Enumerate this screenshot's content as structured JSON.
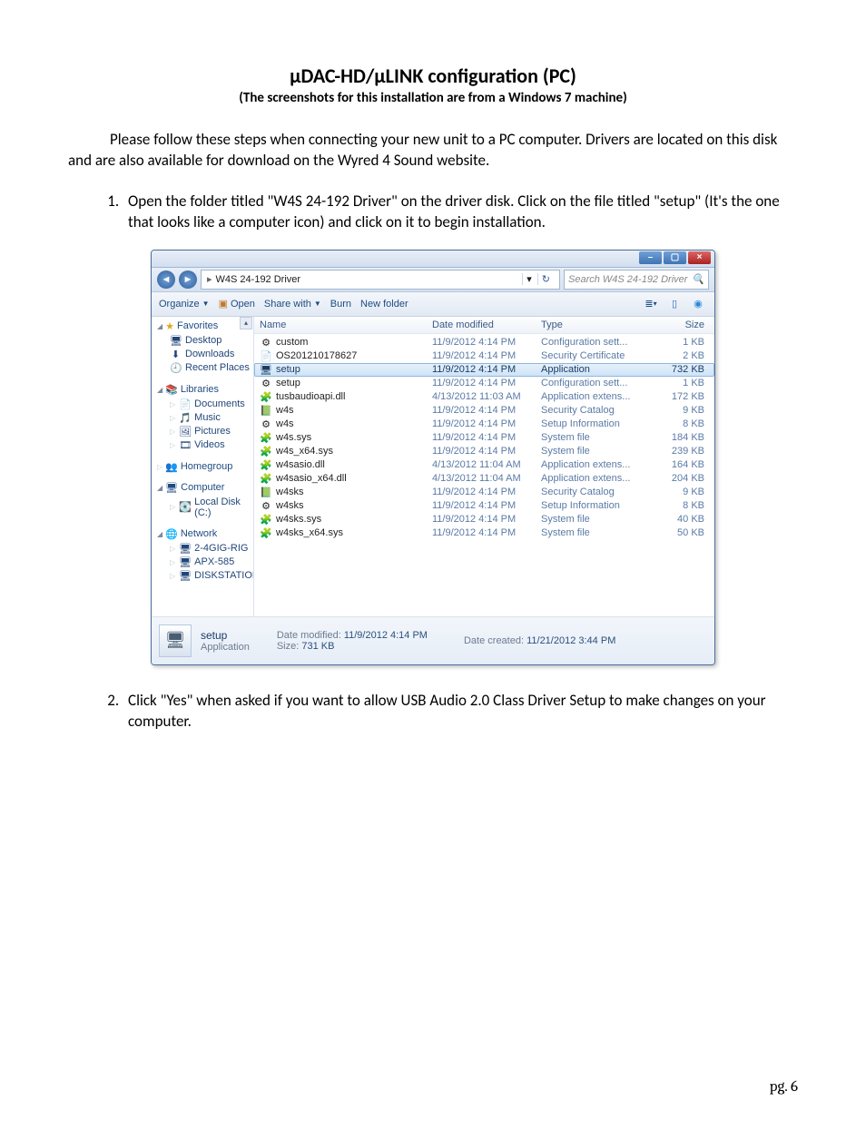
{
  "doc": {
    "title": "µDAC-HD/µLINK configuration (PC)",
    "subtitle": "(The screenshots for this installation are from a Windows 7 machine)",
    "intro": "Please follow these steps when connecting your new unit to a PC computer. Drivers are located on this disk and are also available for download on the Wyred 4 Sound website.",
    "step1": "Open the folder titled \"W4S 24-192 Driver\" on the driver disk. Click on the file titled \"setup\" (It's the one that looks like a computer icon) and click on it to begin installation.",
    "step2": "Click \"Yes\" when asked if you want to allow USB Audio 2.0 Class Driver Setup to make changes on your computer.",
    "pagenum": "pg. 6"
  },
  "explorer": {
    "breadcrumb": "W4S 24-192 Driver",
    "search_placeholder": "Search W4S 24-192 Driver",
    "toolbar": {
      "organize": "Organize",
      "open": "Open",
      "share": "Share with",
      "burn": "Burn",
      "newfolder": "New folder"
    },
    "columns": {
      "name": "Name",
      "date": "Date modified",
      "type": "Type",
      "size": "Size"
    },
    "sidebar": {
      "favorites": "Favorites",
      "favorites_items": [
        "Desktop",
        "Downloads",
        "Recent Places"
      ],
      "libraries": "Libraries",
      "libraries_items": [
        "Documents",
        "Music",
        "Pictures",
        "Videos"
      ],
      "homegroup": "Homegroup",
      "computer": "Computer",
      "computer_items": [
        "Local Disk (C:)"
      ],
      "network": "Network",
      "network_items": [
        "2-4GIG-RIG",
        "APX-585",
        "DISKSTATION"
      ]
    },
    "files": [
      {
        "icon": "⚙",
        "name": "custom",
        "date": "11/9/2012 4:14 PM",
        "type": "Configuration sett...",
        "size": "1 KB"
      },
      {
        "icon": "📄",
        "name": "OS201210178627",
        "date": "11/9/2012 4:14 PM",
        "type": "Security Certificate",
        "size": "2 KB"
      },
      {
        "icon": "🖥",
        "name": "setup",
        "date": "11/9/2012 4:14 PM",
        "type": "Application",
        "size": "732 KB",
        "selected": true
      },
      {
        "icon": "⚙",
        "name": "setup",
        "date": "11/9/2012 4:14 PM",
        "type": "Configuration sett...",
        "size": "1 KB"
      },
      {
        "icon": "🧩",
        "name": "tusbaudioapi.dll",
        "date": "4/13/2012 11:03 AM",
        "type": "Application extens...",
        "size": "172 KB"
      },
      {
        "icon": "📗",
        "name": "w4s",
        "date": "11/9/2012 4:14 PM",
        "type": "Security Catalog",
        "size": "9 KB"
      },
      {
        "icon": "⚙",
        "name": "w4s",
        "date": "11/9/2012 4:14 PM",
        "type": "Setup Information",
        "size": "8 KB"
      },
      {
        "icon": "🧩",
        "name": "w4s.sys",
        "date": "11/9/2012 4:14 PM",
        "type": "System file",
        "size": "184 KB"
      },
      {
        "icon": "🧩",
        "name": "w4s_x64.sys",
        "date": "11/9/2012 4:14 PM",
        "type": "System file",
        "size": "239 KB"
      },
      {
        "icon": "🧩",
        "name": "w4sasio.dll",
        "date": "4/13/2012 11:04 AM",
        "type": "Application extens...",
        "size": "164 KB"
      },
      {
        "icon": "🧩",
        "name": "w4sasio_x64.dll",
        "date": "4/13/2012 11:04 AM",
        "type": "Application extens...",
        "size": "204 KB"
      },
      {
        "icon": "📗",
        "name": "w4sks",
        "date": "11/9/2012 4:14 PM",
        "type": "Security Catalog",
        "size": "9 KB"
      },
      {
        "icon": "⚙",
        "name": "w4sks",
        "date": "11/9/2012 4:14 PM",
        "type": "Setup Information",
        "size": "8 KB"
      },
      {
        "icon": "🧩",
        "name": "w4sks.sys",
        "date": "11/9/2012 4:14 PM",
        "type": "System file",
        "size": "40 KB"
      },
      {
        "icon": "🧩",
        "name": "w4sks_x64.sys",
        "date": "11/9/2012 4:14 PM",
        "type": "System file",
        "size": "50 KB"
      }
    ],
    "status": {
      "name": "setup",
      "type": "Application",
      "modified_label": "Date modified:",
      "modified_value": "11/9/2012 4:14 PM",
      "size_label": "Size:",
      "size_value": "731 KB",
      "created_label": "Date created:",
      "created_value": "11/21/2012 3:44 PM"
    }
  }
}
